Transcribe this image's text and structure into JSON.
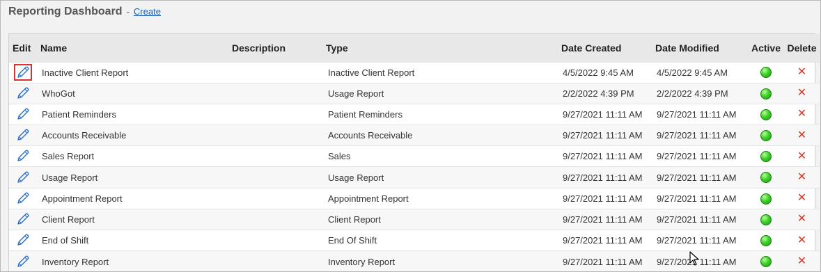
{
  "header": {
    "title": "Reporting Dashboard",
    "separator": "-",
    "create_label": "Create"
  },
  "table": {
    "columns": {
      "edit": "Edit",
      "name": "Name",
      "description": "Description",
      "type": "Type",
      "date_created": "Date Created",
      "date_modified": "Date Modified",
      "active": "Active",
      "delete": "Delete"
    },
    "rows": [
      {
        "name": "Inactive Client Report",
        "description": "",
        "type": "Inactive Client Report",
        "date_created": "4/5/2022 9:45 AM",
        "date_modified": "4/5/2022 9:45 AM",
        "active": true
      },
      {
        "name": "WhoGot",
        "description": "",
        "type": "Usage Report",
        "date_created": "2/2/2022 4:39 PM",
        "date_modified": "2/2/2022 4:39 PM",
        "active": true
      },
      {
        "name": "Patient Reminders",
        "description": "",
        "type": "Patient Reminders",
        "date_created": "9/27/2021 11:11 AM",
        "date_modified": "9/27/2021 11:11 AM",
        "active": true
      },
      {
        "name": "Accounts Receivable",
        "description": "",
        "type": "Accounts Receivable",
        "date_created": "9/27/2021 11:11 AM",
        "date_modified": "9/27/2021 11:11 AM",
        "active": true
      },
      {
        "name": "Sales Report",
        "description": "",
        "type": "Sales",
        "date_created": "9/27/2021 11:11 AM",
        "date_modified": "9/27/2021 11:11 AM",
        "active": true
      },
      {
        "name": "Usage Report",
        "description": "",
        "type": "Usage Report",
        "date_created": "9/27/2021 11:11 AM",
        "date_modified": "9/27/2021 11:11 AM",
        "active": true
      },
      {
        "name": "Appointment Report",
        "description": "",
        "type": "Appointment Report",
        "date_created": "9/27/2021 11:11 AM",
        "date_modified": "9/27/2021 11:11 AM",
        "active": true
      },
      {
        "name": "Client Report",
        "description": "",
        "type": "Client Report",
        "date_created": "9/27/2021 11:11 AM",
        "date_modified": "9/27/2021 11:11 AM",
        "active": true
      },
      {
        "name": "End of Shift",
        "description": "",
        "type": "End Of Shift",
        "date_created": "9/27/2021 11:11 AM",
        "date_modified": "9/27/2021 11:11 AM",
        "active": true
      },
      {
        "name": "Inventory Report",
        "description": "",
        "type": "Inventory Report",
        "date_created": "9/27/2021 11:11 AM",
        "date_modified": "9/27/2021 11:11 AM",
        "active": true
      }
    ]
  },
  "icons": {
    "edit": "pencil-icon",
    "active": "status-dot-icon",
    "delete": "close-icon",
    "cursor": "mouse-cursor-icon"
  },
  "colors": {
    "link": "#1a5fb4",
    "delete": "#d13a2a",
    "active": "#3fd12a",
    "focus_outline": "#d93232"
  }
}
